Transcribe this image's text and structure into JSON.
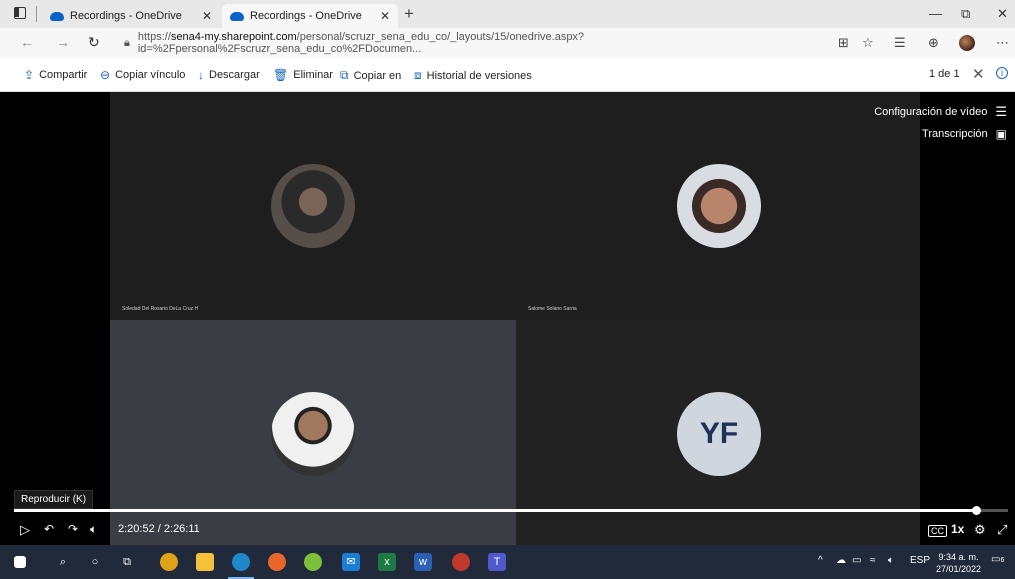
{
  "browser": {
    "tabs": [
      {
        "title": "Recordings - OneDrive",
        "active": false
      },
      {
        "title": "Recordings - OneDrive",
        "active": true
      }
    ],
    "url_prefix": "https://",
    "url_domain": "sena4-my.sharepoint.com",
    "url_rest": "/personal/scruzr_sena_edu_co/_layouts/15/onedrive.aspx?id=%2Fpersonal%2Fscruzr_sena_edu_co%2FDocumen...",
    "window_controls": {
      "minimize": "—",
      "maximize": "⧉",
      "close": "✕"
    }
  },
  "commands": [
    {
      "icon": "share-icon",
      "glyph": "⇪",
      "label": "Compartir"
    },
    {
      "icon": "link-icon",
      "glyph": "⊖",
      "label": "Copiar vínculo"
    },
    {
      "icon": "download-icon",
      "glyph": "↓",
      "label": "Descargar"
    },
    {
      "icon": "delete-icon",
      "glyph": "🗑",
      "label": "Eliminar"
    },
    {
      "icon": "copy-icon",
      "glyph": "⧉",
      "label": "Copiar en"
    },
    {
      "icon": "history-icon",
      "glyph": "⧈",
      "label": "Historial de versiones"
    }
  ],
  "pager": {
    "text": "1 de 1"
  },
  "video": {
    "settings_label": "Configuración de vídeo",
    "transcript_label": "Transcripción",
    "participants": [
      {
        "name": "Soledad Del Rosario DeLa Cruz H",
        "initials": ""
      },
      {
        "name": "Salome Solano Sarria",
        "initials": ""
      },
      {
        "name": "",
        "initials": ""
      },
      {
        "name": "",
        "initials": "YF"
      }
    ],
    "tooltip": "Reproducir (K)",
    "time_current": "2:20:52",
    "time_separator": "/",
    "time_total": "2:26:11",
    "progress": 0.9682,
    "speed": "1x",
    "cc": "CC"
  },
  "taskbar": {
    "lang": "ESP",
    "time": "9:34 a. m.",
    "date": "27/01/2022",
    "notifications": "6"
  }
}
